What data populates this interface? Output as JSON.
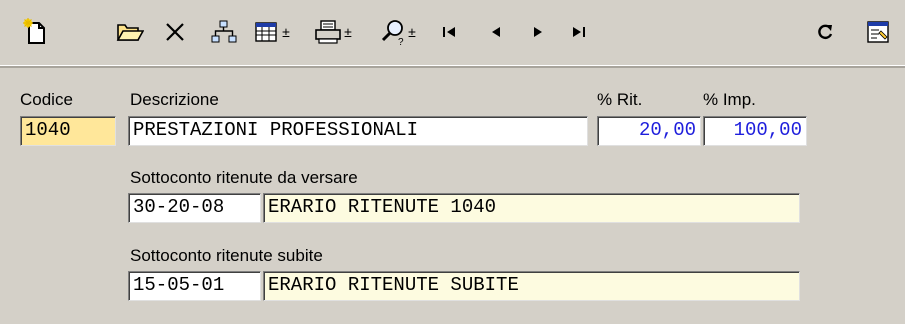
{
  "toolbar": {
    "icons": [
      "new-document-icon",
      "open-folder-icon",
      "delete-icon",
      "hierarchy-icon",
      "table-view-icon",
      "print-icon",
      "find-icon",
      "first-record-icon",
      "previous-record-icon",
      "next-record-icon",
      "last-record-icon",
      "refresh-icon",
      "properties-icon"
    ],
    "dropdown_glyph": "±"
  },
  "form": {
    "codice_label": "Codice",
    "codice_value": "1040",
    "descrizione_label": "Descrizione",
    "descrizione_value": "PRESTAZIONI PROFESSIONALI",
    "rit_label": "% Rit.",
    "rit_value": "20,00",
    "imp_label": "% Imp.",
    "imp_value": "100,00",
    "versare_label": "Sottoconto ritenute da versare",
    "versare_code": "30-20-08",
    "versare_desc": "ERARIO RITENUTE 1040",
    "subite_label": "Sottoconto ritenute subite",
    "subite_code": "15-05-01",
    "subite_desc": "ERARIO RITENUTE SUBITE"
  },
  "colors": {
    "background": "#d4d0c8",
    "highlight_field": "#ffe79a",
    "readonly_field": "#fdfbe0",
    "numeric_text": "#1e1edc"
  }
}
